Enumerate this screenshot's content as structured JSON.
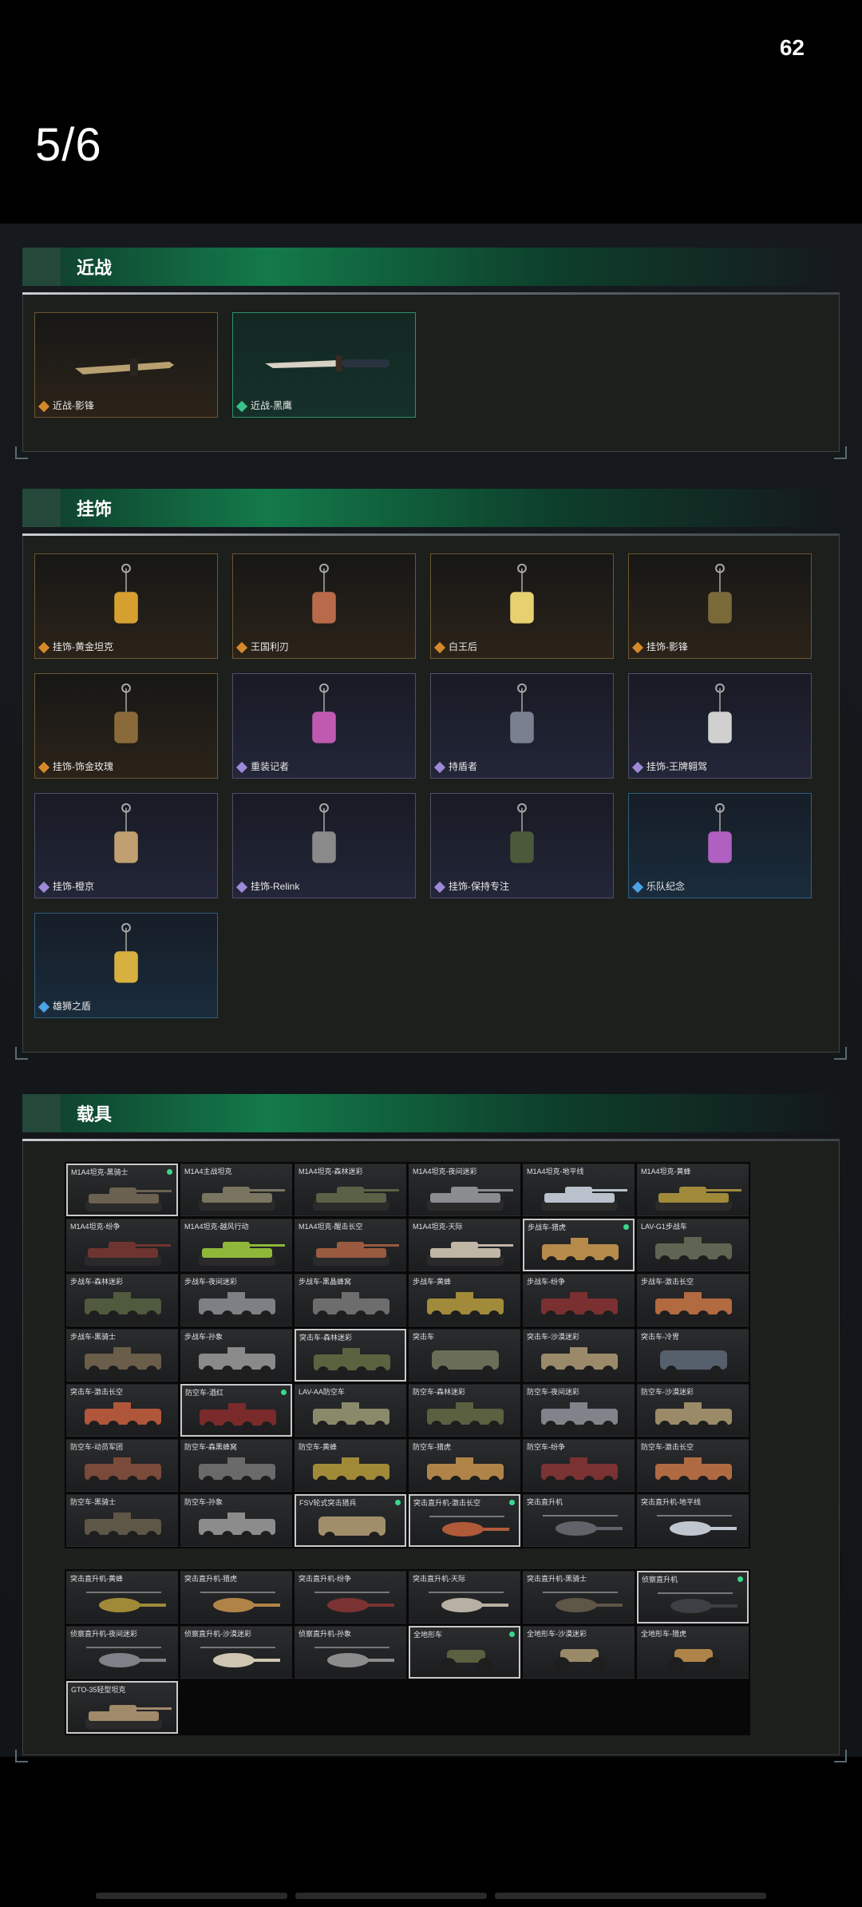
{
  "status": {
    "badge": "62"
  },
  "pager": {
    "label": "5/6"
  },
  "colors": {
    "accent_green": "#137a4a",
    "gold_rarity": "#d6892a",
    "green_rarity": "#3bc08a",
    "purple_rarity": "#9c8ad8",
    "blue_rarity": "#4ba3e6"
  },
  "melee": {
    "title": "近战",
    "items": [
      {
        "label": "近战-影锋",
        "rarity": "gold"
      },
      {
        "label": "近战-黑鹰",
        "rarity": "green"
      }
    ]
  },
  "charms": {
    "title": "挂饰",
    "items": [
      {
        "label": "挂饰-黄金坦克",
        "rarity": "gold"
      },
      {
        "label": "王国利刃",
        "rarity": "gold"
      },
      {
        "label": "白王后",
        "rarity": "gold"
      },
      {
        "label": "挂饰-影锋",
        "rarity": "gold"
      },
      {
        "label": "挂饰-饰金玫瑰",
        "rarity": "gold"
      },
      {
        "label": "重装记者",
        "rarity": "purple"
      },
      {
        "label": "持盾者",
        "rarity": "purple"
      },
      {
        "label": "挂饰-王牌翱驾",
        "rarity": "purple"
      },
      {
        "label": "挂饰-橙京",
        "rarity": "purple"
      },
      {
        "label": "挂饰-Relink",
        "rarity": "purple"
      },
      {
        "label": "挂饰-保持专注",
        "rarity": "purple"
      },
      {
        "label": "乐队纪念",
        "rarity": "blue"
      },
      {
        "label": "雄狮之盾",
        "rarity": "blue"
      }
    ]
  },
  "vehicles": {
    "title": "载具",
    "grid1": [
      {
        "name": "M1A4坦克-黑骑士",
        "sel": true,
        "dot": true,
        "kind": "tank",
        "color": "#6b6150"
      },
      {
        "name": "M1A4主战坦克",
        "kind": "tank",
        "color": "#7a7560"
      },
      {
        "name": "M1A4坦克-森林迷彩",
        "kind": "tank",
        "color": "#5a6146"
      },
      {
        "name": "M1A4坦克-夜间迷彩",
        "kind": "tank",
        "color": "#8a8c90"
      },
      {
        "name": "M1A4坦克-地平线",
        "kind": "tank",
        "color": "#b9c2cc"
      },
      {
        "name": "M1A4坦克-黄蜂",
        "kind": "tank",
        "color": "#a08a3a"
      },
      {
        "name": "M1A4坦克-纷争",
        "kind": "tank",
        "color": "#6e3530"
      },
      {
        "name": "M1A4坦克-越风行动",
        "kind": "tank",
        "color": "#8fb83a"
      },
      {
        "name": "M1A4坦克-醒击长空",
        "kind": "tank",
        "color": "#9a5a40"
      },
      {
        "name": "M1A4坦克-天际",
        "kind": "tank",
        "color": "#c0b6a6"
      },
      {
        "name": "步战车-猎虎",
        "sel": true,
        "dot": true,
        "kind": "ifv",
        "color": "#b58a4a"
      },
      {
        "name": "LAV-G1步战车",
        "kind": "ifv",
        "color": "#5e6552"
      },
      {
        "name": "步战车-森林迷彩",
        "kind": "ifv",
        "color": "#4f5a3e"
      },
      {
        "name": "步战车-夜间迷彩",
        "kind": "ifv",
        "color": "#7e8086"
      },
      {
        "name": "步战车-黑晶蜂窝",
        "kind": "ifv",
        "color": "#6d6d6d"
      },
      {
        "name": "步战车-黄蜂",
        "kind": "ifv",
        "color": "#a18a3a"
      },
      {
        "name": "步战车-纷争",
        "kind": "ifv",
        "color": "#7a3030"
      },
      {
        "name": "步战车-激击长空",
        "kind": "ifv",
        "color": "#b26a40"
      },
      {
        "name": "步战车-黑骑士",
        "kind": "ifv",
        "color": "#6a5e4a"
      },
      {
        "name": "步战车-孙象",
        "kind": "ifv",
        "color": "#8a8a8a"
      },
      {
        "name": "突击车-森林迷彩",
        "sel": true,
        "kind": "ifv",
        "color": "#5a6240"
      },
      {
        "name": "突击车",
        "kind": "truck",
        "color": "#6a6e58"
      },
      {
        "name": "突击车-沙漠迷彩",
        "kind": "ifv",
        "color": "#9a8a6a"
      },
      {
        "name": "突击车-冷冑",
        "kind": "truck",
        "color": "#56606c"
      },
      {
        "name": "突击车-激击长空",
        "kind": "ifv",
        "color": "#b0563a"
      },
      {
        "name": "防空车-酒红",
        "sel": true,
        "dot": true,
        "kind": "ifv",
        "color": "#7a2a2a"
      },
      {
        "name": "LAV-AA防空车",
        "kind": "ifv",
        "color": "#8a8a6a"
      },
      {
        "name": "防空车-森林迷彩",
        "kind": "ifv",
        "color": "#5a6040"
      },
      {
        "name": "防空车-夜间迷彩",
        "kind": "ifv",
        "color": "#80848a"
      },
      {
        "name": "防空车-沙漠迷彩",
        "kind": "ifv",
        "color": "#9a8a68"
      },
      {
        "name": "防空车-动员军团",
        "kind": "ifv",
        "color": "#7a4a3a"
      },
      {
        "name": "防空车-森黑蜂窝",
        "kind": "ifv",
        "color": "#6a6a6a"
      },
      {
        "name": "防空车-黄蜂",
        "kind": "ifv",
        "color": "#a08a38"
      },
      {
        "name": "防空车-猎虎",
        "kind": "ifv",
        "color": "#b08448"
      },
      {
        "name": "防空车-纷争",
        "kind": "ifv",
        "color": "#7a3232"
      },
      {
        "name": "防空车-激击长空",
        "kind": "ifv",
        "color": "#b06a42"
      },
      {
        "name": "防空车-黑骑士",
        "kind": "ifv",
        "color": "#5e5646"
      },
      {
        "name": "防空车-孙象",
        "kind": "ifv",
        "color": "#8c8c8c"
      },
      {
        "name": "FSV轮式突击猎兵",
        "sel": true,
        "dot": true,
        "kind": "truck",
        "color": "#a08e6a"
      },
      {
        "name": "突击直升机-激击长空",
        "sel": true,
        "dot": true,
        "kind": "heli",
        "color": "#b05a3a"
      },
      {
        "name": "突击直升机",
        "kind": "heli",
        "color": "#60646a"
      },
      {
        "name": "突击直升机-地平线",
        "kind": "heli",
        "color": "#c0c6d0"
      }
    ],
    "grid2": [
      {
        "name": "突击直升机-黄蜂",
        "kind": "heli",
        "color": "#a08a38"
      },
      {
        "name": "突击直升机-猎虎",
        "kind": "heli",
        "color": "#b08448"
      },
      {
        "name": "突击直升机-纷争",
        "kind": "heli",
        "color": "#7a3232"
      },
      {
        "name": "突击直升机-天际",
        "kind": "heli",
        "color": "#b8b0a2"
      },
      {
        "name": "突击直升机-黑骑士",
        "kind": "heli",
        "color": "#5e5646"
      },
      {
        "name": "侦察直升机",
        "sel": true,
        "dot": true,
        "kind": "heli",
        "color": "#3c4044"
      },
      {
        "name": "侦察直升机-夜间迷彩",
        "kind": "heli",
        "color": "#7e8288"
      },
      {
        "name": "侦察直升机-沙漠迷彩",
        "kind": "heli",
        "color": "#cfc6b2"
      },
      {
        "name": "侦察直升机-孙象",
        "kind": "heli",
        "color": "#8c8c8c"
      },
      {
        "name": "全地形车",
        "sel": true,
        "dot": true,
        "kind": "atv",
        "color": "#5a6040"
      },
      {
        "name": "全地形车-沙漠迷彩",
        "kind": "atv",
        "color": "#9a8a68"
      },
      {
        "name": "全地形车-猎虎",
        "kind": "atv",
        "color": "#b08448"
      },
      {
        "name": "GTO-35轻型坦克",
        "sel": true,
        "kind": "tank",
        "color": "#a08a6a"
      }
    ]
  }
}
